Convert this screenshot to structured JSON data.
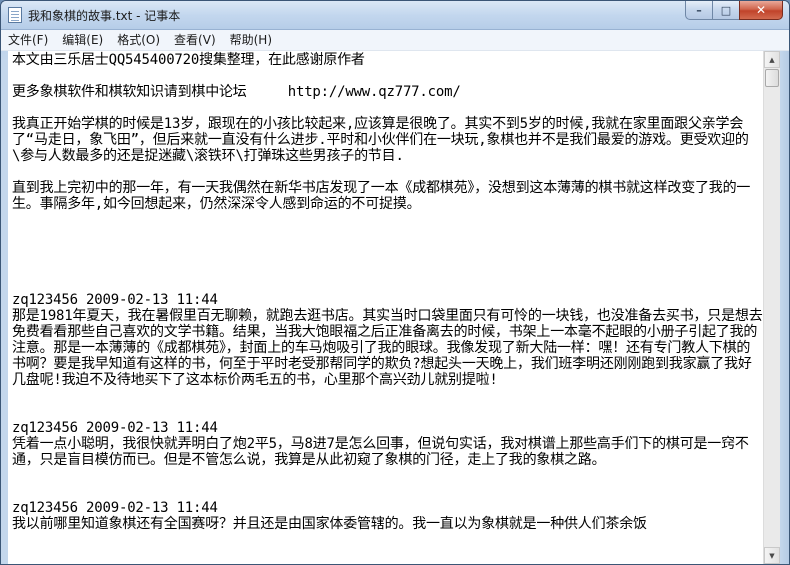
{
  "window": {
    "title": "我和象棋的故事.txt - 记事本",
    "icon": "notepad-icon"
  },
  "caption": {
    "minimize_glyph": "–",
    "maximize_glyph": "□",
    "close_glyph": "✕"
  },
  "menu": {
    "items": [
      {
        "label": "文件(F)"
      },
      {
        "label": "编辑(E)"
      },
      {
        "label": "格式(O)"
      },
      {
        "label": "查看(V)"
      },
      {
        "label": "帮助(H)"
      }
    ]
  },
  "document": {
    "content": "本文由三乐居士QQ545400720搜集整理，在此感谢原作者\n\n更多象棋软件和棋软知识请到棋中论坛     http://www.qz777.com/\n\n我真正开始学棋的时候是13岁，跟现在的小孩比较起来,应该算是很晚了。其实不到5岁的时候,我就在家里面跟父亲学会了“马走日，象飞田”，但后来就一直没有什么进步.平时和小伙伴们在一块玩,象棋也并不是我们最爱的游戏。更受欢迎的\\参与人数最多的还是捉迷藏\\滚铁环\\打弹珠这些男孩子的节目.\n\n直到我上完初中的那一年，有一天我偶然在新华书店发现了一本《成都棋苑》，没想到这本薄薄的棋书就这样改变了我的一生。事隔多年,如今回想起来，仍然深深令人感到命运的不可捉摸。\n\n\n\n\n\nzq123456 2009-02-13 11:44\n那是1981年夏天，我在暑假里百无聊赖，就跑去逛书店。其实当时口袋里面只有可怜的一块钱，也没准备去买书，只是想去免费看看那些自己喜欢的文学书籍。结果，当我大饱眼福之后正准备离去的时候，书架上一本毫不起眼的小册子引起了我的注意。那是一本薄薄的《成都棋苑》，封面上的车马炮吸引了我的眼球。我像发现了新大陆一样：嘿！还有专门教人下棋的书啊？要是我早知道有这样的书，何至于平时老受那帮同学的欺负?想起头一天晚上，我们班李明还刚刚跑到我家赢了我好几盘呢!我迫不及待地买下了这本标价两毛五的书，心里那个高兴劲儿就别提啦!\n\n\nzq123456 2009-02-13 11:44\n凭着一点小聪明，我很快就弄明白了炮2平5，马8进7是怎么回事，但说句实话，我对棋谱上那些高手们下的棋可是一窍不通，只是盲目模仿而已。但是不管怎么说，我算是从此初窥了象棋的门径，走上了我的象棋之路。\n\n\nzq123456 2009-02-13 11:44\n我以前哪里知道象棋还有全国赛呀？并且还是由国家体委管辖的。我一直以为象棋就是一种供人们茶余饭"
  },
  "scrollbar": {
    "up_glyph": "▲",
    "down_glyph": "▼",
    "position_fraction": 0
  }
}
